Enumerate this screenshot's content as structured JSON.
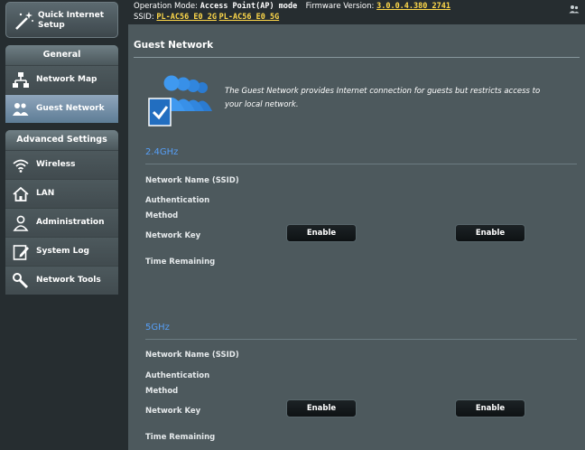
{
  "status": {
    "operation_mode_label": "Operation Mode:",
    "operation_mode_value": "Access Point(AP) mode",
    "firmware_label": "Firmware Version:",
    "firmware_value": "3.0.0.4.380_2741",
    "ssid_label": "SSID:",
    "ssid_2g": "PL-AC56_E0_2G",
    "ssid_5g": "PL-AC56_E0_5G"
  },
  "sidebar": {
    "quick_setup": "Quick Internet Setup",
    "general_title": "General",
    "general_items": [
      {
        "label": "Network Map",
        "icon": "network-map-icon"
      },
      {
        "label": "Guest Network",
        "icon": "guest-network-icon"
      }
    ],
    "advanced_title": "Advanced Settings",
    "advanced_items": [
      {
        "label": "Wireless",
        "icon": "wifi-icon"
      },
      {
        "label": "LAN",
        "icon": "home-icon"
      },
      {
        "label": "Administration",
        "icon": "admin-user-icon"
      },
      {
        "label": "System Log",
        "icon": "system-log-icon"
      },
      {
        "label": "Network Tools",
        "icon": "tools-icon"
      }
    ]
  },
  "main": {
    "title": "Guest Network",
    "description": "The Guest Network provides Internet connection for guests but restricts access to your local network.",
    "bands": [
      {
        "title": "2.4GHz",
        "labels": {
          "ssid": "Network Name (SSID)",
          "auth": "Authentication",
          "method": "Method",
          "key": "Network Key",
          "time": "Time Remaining"
        },
        "buttons": [
          "Enable",
          "Enable"
        ]
      },
      {
        "title": "5GHz",
        "labels": {
          "ssid": "Network Name (SSID)",
          "auth": "Authentication",
          "method": "Method",
          "key": "Network Key",
          "time": "Time Remaining"
        },
        "buttons": [
          "Enable",
          "Enable"
        ]
      }
    ]
  },
  "colors": {
    "background": "#262d30",
    "panel": "#4d595d",
    "accent_blue": "#569ff7",
    "link_yellow": "#ffd94a"
  }
}
